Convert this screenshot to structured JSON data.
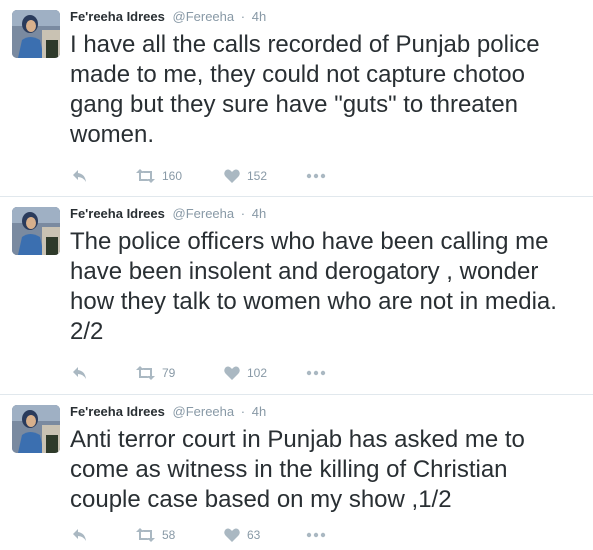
{
  "tweets": [
    {
      "name": "Fe'reeha Idrees",
      "handle": "@Fereeha",
      "separator": "·",
      "time": "4h",
      "text": "I have all the calls recorded of Punjab police made to me, they could not capture chotoo gang but they sure have \"guts\" to threaten women.",
      "retweets": "160",
      "likes": "152"
    },
    {
      "name": "Fe'reeha Idrees",
      "handle": "@Fereeha",
      "separator": "·",
      "time": "4h",
      "text": "The police officers who have been calling me have been insolent and derogatory , wonder how they talk to women who are not in media. 2/2",
      "retweets": "79",
      "likes": "102"
    },
    {
      "name": "Fe'reeha Idrees",
      "handle": "@Fereeha",
      "separator": "·",
      "time": "4h",
      "text": "Anti terror court in Punjab has asked me to come as witness in the killing of Christian couple case based on my show ,1/2",
      "retweets": "58",
      "likes": "63"
    }
  ],
  "icons": {
    "reply": "reply-icon",
    "retweet": "retweet-icon",
    "like": "heart-icon",
    "more": "more-icon"
  },
  "colors": {
    "text": "#292f33",
    "meta": "#8899a6",
    "icon": "#aab8c2",
    "divider": "#e1e8ed"
  }
}
